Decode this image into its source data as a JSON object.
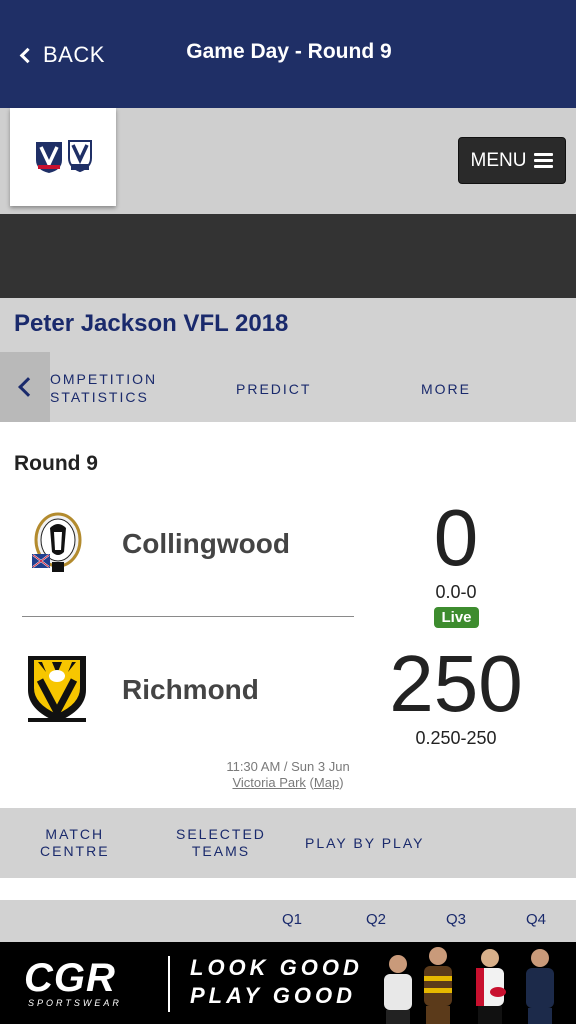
{
  "nav": {
    "back_label": "BACK",
    "title": "Game Day - Round 9"
  },
  "menu": {
    "label": "MENU"
  },
  "competition": {
    "title": "Peter Jackson VFL 2018",
    "tabs": [
      {
        "label_line1": "OMPETITION",
        "label_line2": "STATISTICS"
      },
      {
        "label": "PREDICT"
      },
      {
        "label": "MORE"
      }
    ]
  },
  "match": {
    "round": "Round 9",
    "home": {
      "name": "Collingwood",
      "score": "0",
      "detail": "0.0-0"
    },
    "status": "Live",
    "away": {
      "name": "Richmond",
      "score": "250",
      "detail": "0.250-250"
    },
    "time": "11:30 AM / Sun 3 Jun",
    "venue": "Victoria Park",
    "map_label": "Map"
  },
  "match_tabs": [
    {
      "line1": "MATCH",
      "line2": "CENTRE"
    },
    {
      "line1": "SELECTED",
      "line2": "TEAMS"
    },
    {
      "line1": "PLAY BY PLAY",
      "line2": ""
    }
  ],
  "quarters": [
    "Q1",
    "Q2",
    "Q3",
    "Q4"
  ],
  "banner": {
    "brand": "CGR",
    "brand_sub": "SPORTSWEAR",
    "slogan_line1": "LOOK GOOD",
    "slogan_line2": "PLAY GOOD"
  },
  "colors": {
    "nav_bg": "#1f2f66",
    "accent_text": "#1a2a6c",
    "live_green": "#3d8c2e",
    "band_grey": "#d2d2d2"
  }
}
